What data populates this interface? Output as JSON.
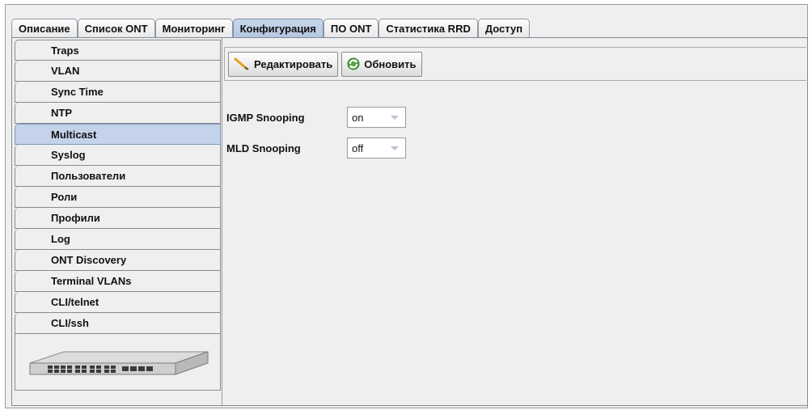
{
  "tabs": [
    {
      "label": "Описание",
      "active": false
    },
    {
      "label": "Список ONT",
      "active": false
    },
    {
      "label": "Мониторинг",
      "active": false
    },
    {
      "label": "Конфигурация",
      "active": true
    },
    {
      "label": "ПО ONT",
      "active": false
    },
    {
      "label": "Статистика RRD",
      "active": false
    },
    {
      "label": "Доступ",
      "active": false
    }
  ],
  "sidebar": {
    "items": [
      {
        "label": "Traps"
      },
      {
        "label": "VLAN"
      },
      {
        "label": "Sync Time"
      },
      {
        "label": "NTP"
      },
      {
        "label": "Multicast",
        "selected": true
      },
      {
        "label": "Syslog"
      },
      {
        "label": "Пользователи"
      },
      {
        "label": "Роли"
      },
      {
        "label": "Профили"
      },
      {
        "label": "Log"
      },
      {
        "label": "ONT Discovery"
      },
      {
        "label": "Terminal VLANs"
      },
      {
        "label": "CLI/telnet"
      },
      {
        "label": "CLI/ssh"
      }
    ],
    "device_image": "switch-device-icon"
  },
  "toolbar": {
    "edit_label": "Редактировать",
    "edit_icon": "pencil-icon",
    "refresh_label": "Обновить",
    "refresh_icon": "refresh-icon"
  },
  "fields": {
    "igmp": {
      "label": "IGMP Snooping",
      "value": "on"
    },
    "mld": {
      "label": "MLD Snooping",
      "value": "off"
    }
  },
  "colors": {
    "active_tab": "#b3c6e2",
    "selected_item": "#c5d3ea",
    "background": "#efefef"
  }
}
